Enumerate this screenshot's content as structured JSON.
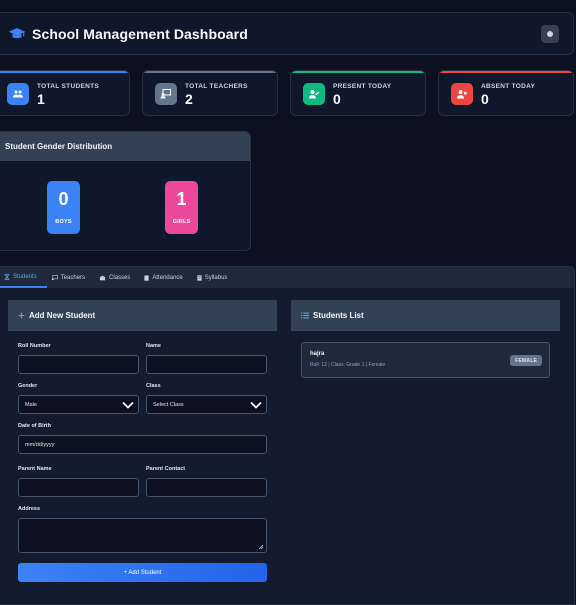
{
  "header": {
    "title": "School Management Dashboard"
  },
  "stats": [
    {
      "label": "TOTAL STUDENTS",
      "value": "1",
      "color": "#3b82f6"
    },
    {
      "label": "TOTAL TEACHERS",
      "value": "2",
      "color": "#64748b"
    },
    {
      "label": "PRESENT TODAY",
      "value": "0",
      "color": "#10b981"
    },
    {
      "label": "ABSENT TODAY",
      "value": "0",
      "color": "#ef4444"
    }
  ],
  "gender": {
    "title": "Student Gender Distribution",
    "boys": {
      "value": "0",
      "label": "BOYS",
      "color": "#3b82f6"
    },
    "girls": {
      "value": "1",
      "label": "GIRLS",
      "color": "#ec4899"
    }
  },
  "tabs": [
    {
      "label": "Students",
      "icon": "graduation-icon"
    },
    {
      "label": "Teachers",
      "icon": "chalkboard-icon"
    },
    {
      "label": "Classes",
      "icon": "building-icon"
    },
    {
      "label": "Attendance",
      "icon": "clipboard-icon"
    },
    {
      "label": "Syllabus",
      "icon": "book-icon"
    }
  ],
  "form": {
    "title": "Add New Student",
    "roll_label": "Roll Number",
    "name_label": "Name",
    "gender_label": "Gender",
    "gender_value": "Male",
    "class_label": "Class",
    "class_value": "Select Class",
    "dob_label": "Date of Birth",
    "dob_placeholder": "mm/dd/yyyy",
    "parent_name_label": "Parent Name",
    "parent_contact_label": "Parent Contact",
    "address_label": "Address",
    "submit_label": "+ Add Student"
  },
  "list": {
    "title": "Students List",
    "students": [
      {
        "name": "hajra",
        "meta": "Roll: 12 | Class: Grade 1 | Female",
        "badge": "FEMALE"
      }
    ]
  }
}
